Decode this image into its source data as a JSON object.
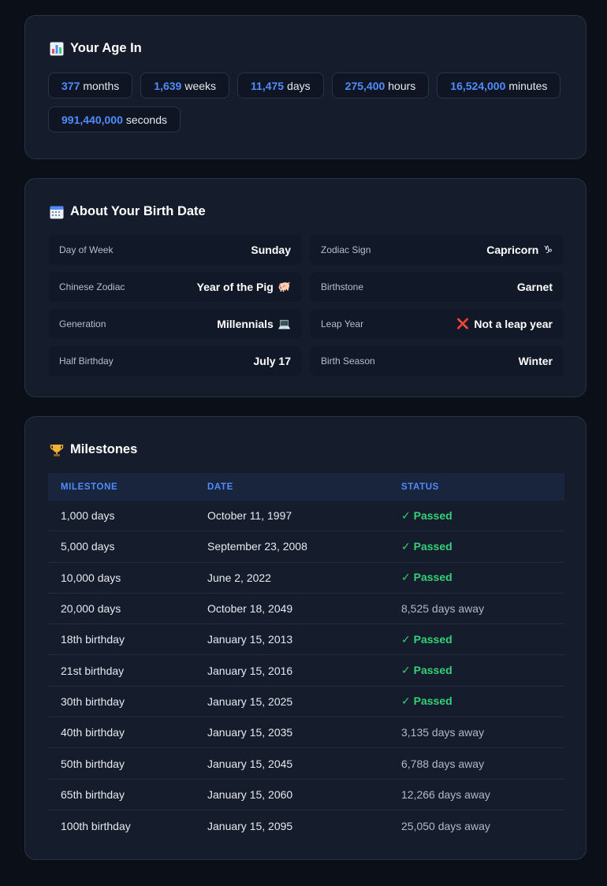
{
  "age": {
    "title": "Your Age In",
    "icon": "bar-chart-icon",
    "items": [
      {
        "value": "377",
        "unit": "months"
      },
      {
        "value": "1,639",
        "unit": "weeks"
      },
      {
        "value": "11,475",
        "unit": "days"
      },
      {
        "value": "275,400",
        "unit": "hours"
      },
      {
        "value": "16,524,000",
        "unit": "minutes"
      },
      {
        "value": "991,440,000",
        "unit": "seconds"
      }
    ]
  },
  "birth": {
    "title": "About Your Birth Date",
    "icon": "calendar-icon",
    "items": [
      {
        "label": "Day of Week",
        "value": "Sunday",
        "emoji": ""
      },
      {
        "label": "Zodiac Sign",
        "value": "Capricorn",
        "emoji": "♑"
      },
      {
        "label": "Chinese Zodiac",
        "value": "Year of the Pig",
        "emoji": "🐖"
      },
      {
        "label": "Birthstone",
        "value": "Garnet",
        "emoji": ""
      },
      {
        "label": "Generation",
        "value": "Millennials",
        "emoji": "💻"
      },
      {
        "label": "Leap Year",
        "value": "Not a leap year",
        "prefix": "❌"
      },
      {
        "label": "Half Birthday",
        "value": "July 17",
        "emoji": ""
      },
      {
        "label": "Birth Season",
        "value": "Winter",
        "emoji": ""
      }
    ]
  },
  "milestones": {
    "title": "Milestones",
    "icon": "trophy-icon",
    "headers": [
      "MILESTONE",
      "DATE",
      "STATUS"
    ],
    "rows": [
      {
        "milestone": "1,000 days",
        "date": "October 11, 1997",
        "status": "✓ Passed",
        "passed": true
      },
      {
        "milestone": "5,000 days",
        "date": "September 23, 2008",
        "status": "✓ Passed",
        "passed": true
      },
      {
        "milestone": "10,000 days",
        "date": "June 2, 2022",
        "status": "✓ Passed",
        "passed": true
      },
      {
        "milestone": "20,000 days",
        "date": "October 18, 2049",
        "status": "8,525 days away",
        "passed": false
      },
      {
        "milestone": "18th birthday",
        "date": "January 15, 2013",
        "status": "✓ Passed",
        "passed": true
      },
      {
        "milestone": "21st birthday",
        "date": "January 15, 2016",
        "status": "✓ Passed",
        "passed": true
      },
      {
        "milestone": "30th birthday",
        "date": "January 15, 2025",
        "status": "✓ Passed",
        "passed": true
      },
      {
        "milestone": "40th birthday",
        "date": "January 15, 2035",
        "status": "3,135 days away",
        "passed": false
      },
      {
        "milestone": "50th birthday",
        "date": "January 15, 2045",
        "status": "6,788 days away",
        "passed": false
      },
      {
        "milestone": "65th birthday",
        "date": "January 15, 2060",
        "status": "12,266 days away",
        "passed": false
      },
      {
        "milestone": "100th birthday",
        "date": "January 15, 2095",
        "status": "25,050 days away",
        "passed": false
      }
    ]
  },
  "colors": {
    "accent": "#4f8cff",
    "passed": "#34d17a",
    "card": "#151c2b",
    "background": "#0b0f17"
  }
}
